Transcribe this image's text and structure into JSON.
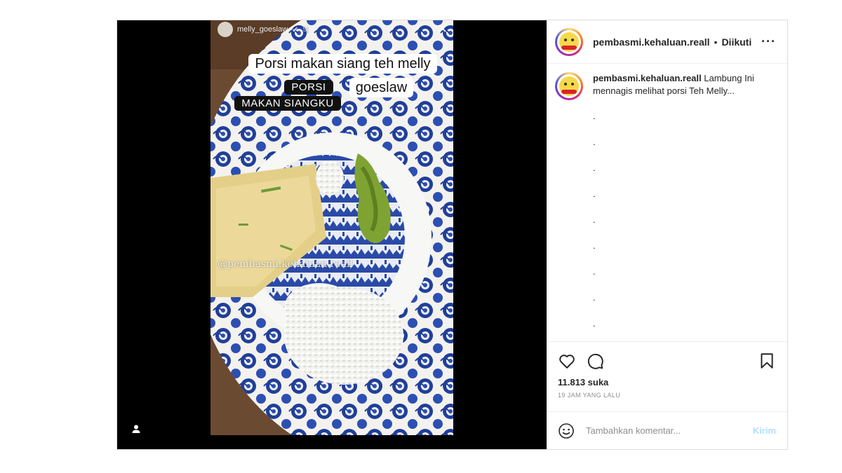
{
  "story": {
    "username": "melly_goeslaw",
    "time": "9j",
    "caption_main_line1": "Porsi makan siang teh melly",
    "caption_main_line2": "goeslaw",
    "caption_small_line1": "PORSI",
    "caption_small_line2": "MAKAN SIANGKU",
    "watermark": "@pembasmi.kehaluan.reall"
  },
  "header": {
    "username": "pembasmi.kehaluan.reall",
    "separator": "•",
    "follow_status": "Diikuti",
    "more_icon": "more-horizontal-icon"
  },
  "caption": {
    "username": "pembasmi.kehaluan.reall",
    "text": "Lambung Ini mennagis melihat porsi Teh Melly...",
    "dots": [
      ".",
      ".",
      ".",
      ".",
      ".",
      ".",
      ".",
      ".",
      "."
    ]
  },
  "actions": {
    "like_icon": "heart-icon",
    "comment_icon": "comment-icon",
    "save_icon": "bookmark-icon",
    "likes": "11.813 suka",
    "time_ago": "19 JAM YANG LALU"
  },
  "comment_box": {
    "placeholder": "Tambahkan komentar...",
    "send_label": "Kirim"
  },
  "colors": {
    "send_disabled": "#b2dffc",
    "plate_blue": "#1f3f9a",
    "muted_text": "#8e8e8e"
  }
}
